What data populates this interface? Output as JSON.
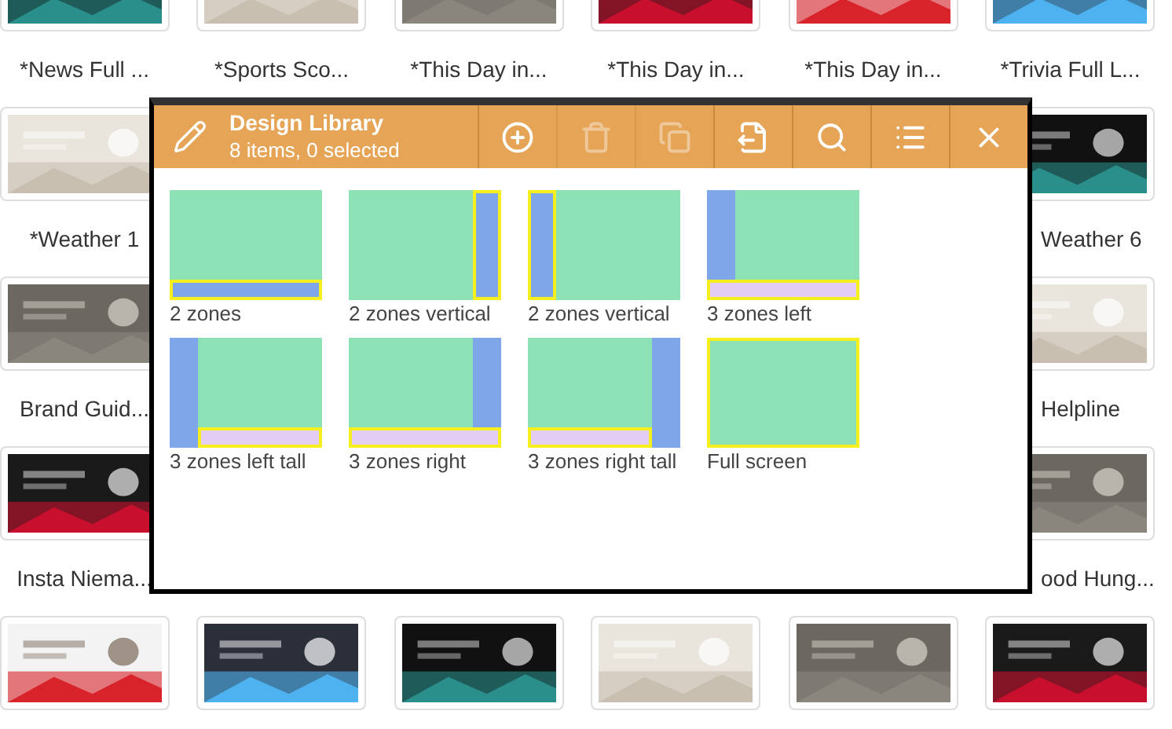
{
  "background": {
    "rows": [
      {
        "tiles": [
          {
            "label": "*News Full ..."
          },
          {
            "label": "*Sports Sco..."
          },
          {
            "label": "*This Day in..."
          },
          {
            "label": "*This Day in..."
          },
          {
            "label": "*This Day in..."
          },
          {
            "label": "*Trivia Full L..."
          }
        ]
      },
      {
        "tiles": [
          {
            "label": "*Weather 1"
          },
          {
            "label": "Weather 6"
          }
        ]
      },
      {
        "tiles": [
          {
            "label": "Brand Guid..."
          },
          {
            "label": "Helpline"
          }
        ]
      },
      {
        "tiles": [
          {
            "label": "Insta Niema..."
          },
          {
            "label": "ood Hung..."
          }
        ]
      },
      {
        "tiles": [
          {
            "kind": "picture"
          },
          {
            "kind": "picture"
          },
          {
            "kind": "picture"
          },
          {
            "kind": "picture"
          },
          {
            "kind": "picture"
          },
          {
            "kind": "picture"
          }
        ]
      }
    ]
  },
  "dialog": {
    "title": "Design Library",
    "subtitle": "8 items, 0 selected",
    "buttons": [
      {
        "kind": "add",
        "disabled": false
      },
      {
        "kind": "delete",
        "disabled": true
      },
      {
        "kind": "copy",
        "disabled": true
      },
      {
        "kind": "export",
        "disabled": false
      },
      {
        "kind": "search",
        "disabled": false
      },
      {
        "kind": "list",
        "disabled": false
      },
      {
        "kind": "close",
        "disabled": false
      }
    ],
    "items": [
      {
        "label": "2 zones",
        "kind": "bottom"
      },
      {
        "label": "2 zones vertical",
        "kind": "right"
      },
      {
        "label": "2 zones vertical",
        "kind": "left"
      },
      {
        "label": "3 zones left",
        "kind": "left-bottom"
      },
      {
        "label": "3 zones left tall",
        "kind": "left-tall"
      },
      {
        "label": "3 zones right",
        "kind": "right-bottom"
      },
      {
        "label": "3 zones right tall",
        "kind": "right-tall"
      },
      {
        "label": "Full screen",
        "kind": "full"
      }
    ]
  }
}
